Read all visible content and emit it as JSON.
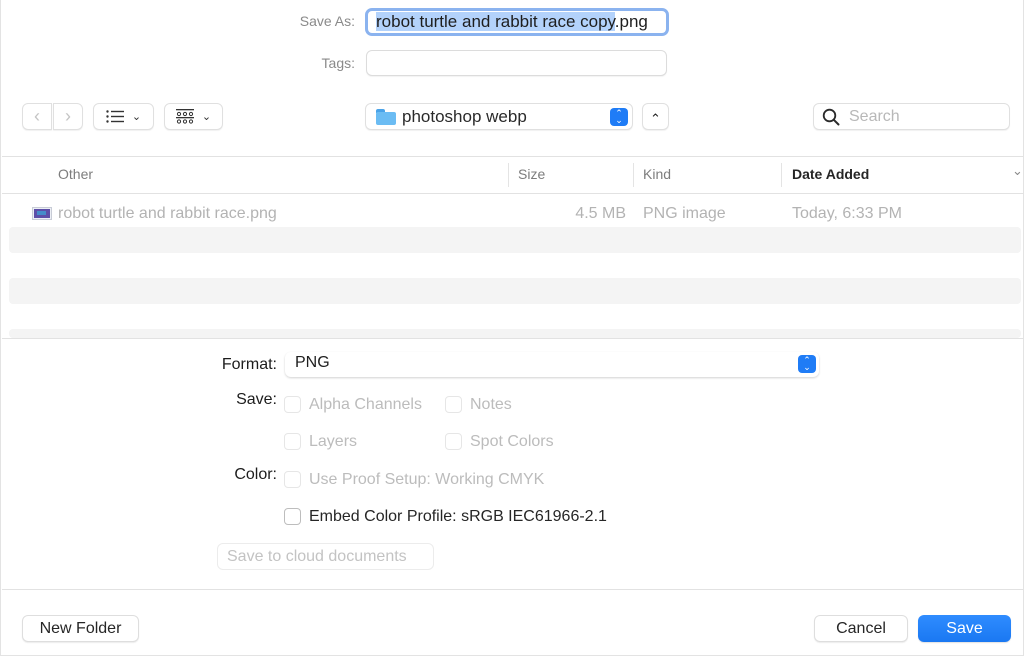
{
  "save_as": {
    "label": "Save As:",
    "value_selected": "robot turtle and rabbit race copy",
    "value_unselected": ".png"
  },
  "tags": {
    "label": "Tags:",
    "value": ""
  },
  "toolbar": {
    "back_icon": "‹",
    "forward_icon": "›",
    "view_list_icon": "list-view",
    "view_gallery_icon": "grid-view",
    "location": "photoshop webp",
    "search_placeholder": "Search"
  },
  "file_list": {
    "columns": [
      "Other",
      "Size",
      "Kind",
      "Date Added"
    ],
    "sorted_column": "Date Added",
    "rows": [
      {
        "name": "robot turtle and rabbit race.png",
        "size": "4.5 MB",
        "kind": "PNG image",
        "date_added": "Today, 6:33 PM"
      }
    ]
  },
  "options": {
    "format_label": "Format:",
    "format_value": "PNG",
    "save_label": "Save:",
    "save_options": [
      {
        "label": "Alpha Channels",
        "checked": false,
        "enabled": false
      },
      {
        "label": "Notes",
        "checked": false,
        "enabled": false
      },
      {
        "label": "Layers",
        "checked": false,
        "enabled": false
      },
      {
        "label": "Spot Colors",
        "checked": false,
        "enabled": false
      }
    ],
    "color_label": "Color:",
    "color_options": [
      {
        "label": "Use Proof Setup:  Working CMYK",
        "checked": false,
        "enabled": false
      },
      {
        "label": "Embed Color Profile:  sRGB IEC61966-2.1",
        "checked": false,
        "enabled": true
      }
    ],
    "cloud_button": "Save to cloud documents"
  },
  "footer": {
    "new_folder": "New Folder",
    "cancel": "Cancel",
    "save": "Save"
  },
  "colors": {
    "accent": "#1f7cf6",
    "selection": "#b3d2fb",
    "focus_ring": "#8bb3ef"
  }
}
